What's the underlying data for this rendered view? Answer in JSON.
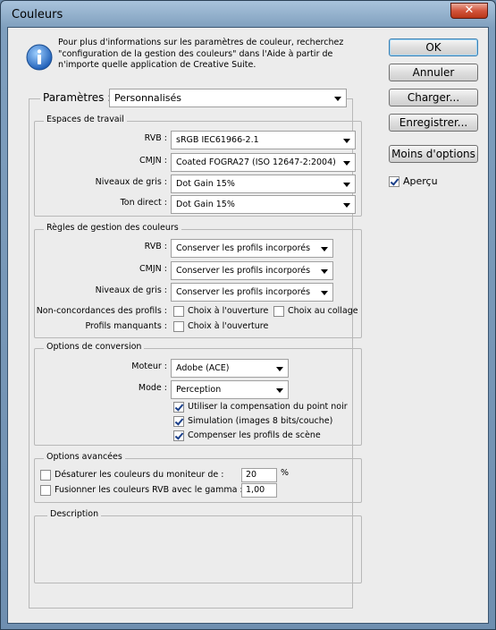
{
  "window": {
    "title": "Couleurs",
    "close_label": "✕"
  },
  "info": {
    "text": "Pour plus d'informations sur les paramètres de couleur, recherchez \"configuration de la gestion des couleurs\" dans l'Aide à partir de n'importe quelle application de Creative Suite."
  },
  "buttons": {
    "ok": "OK",
    "cancel": "Annuler",
    "load": "Charger...",
    "save": "Enregistrer...",
    "fewer_options": "Moins d'options",
    "preview_label": "Aperçu",
    "preview_checked": true
  },
  "settings": {
    "label": "Paramètres :",
    "value": "Personnalisés"
  },
  "working_spaces": {
    "title": "Espaces de travail",
    "rows": [
      {
        "label": "RVB :",
        "value": "sRGB IEC61966-2.1"
      },
      {
        "label": "CMJN :",
        "value": "Coated FOGRA27 (ISO 12647-2:2004)"
      },
      {
        "label": "Niveaux de gris :",
        "value": "Dot Gain 15%"
      },
      {
        "label": "Ton direct :",
        "value": "Dot Gain 15%"
      }
    ]
  },
  "policies": {
    "title": "Règles de gestion des couleurs",
    "rows": [
      {
        "label": "RVB :",
        "value": "Conserver les profils incorporés"
      },
      {
        "label": "CMJN :",
        "value": "Conserver les profils incorporés"
      },
      {
        "label": "Niveaux de gris :",
        "value": "Conserver les profils incorporés"
      }
    ],
    "mismatch_label": "Non-concordances des profils :",
    "ask_open": "Choix à l'ouverture",
    "ask_paste": "Choix au collage",
    "missing_label": "Profils manquants :",
    "missing_ask_open": "Choix à l'ouverture"
  },
  "conversion": {
    "title": "Options de conversion",
    "engine_label": "Moteur :",
    "engine_value": "Adobe (ACE)",
    "intent_label": "Mode :",
    "intent_value": "Perception",
    "bpc": "Utiliser la compensation du point noir",
    "dither": "Simulation (images 8 bits/couche)",
    "scene": "Compenser les profils de scène"
  },
  "advanced": {
    "title": "Options avancées",
    "desaturate_label": "Désaturer les couleurs du moniteur de :",
    "desaturate_value": "20",
    "desaturate_unit": "%",
    "blend_label": "Fusionner les couleurs RVB avec le gamma :",
    "blend_value": "1,00"
  },
  "description": {
    "title": "Description"
  }
}
